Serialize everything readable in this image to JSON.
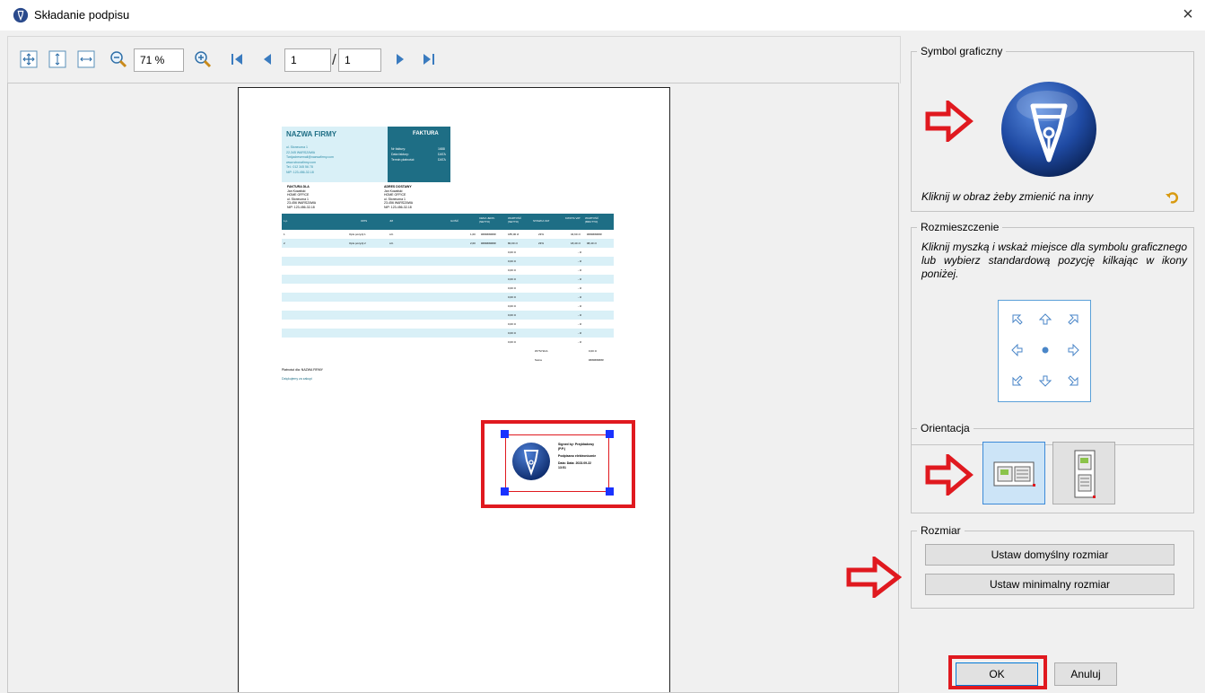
{
  "window": {
    "title": "Składanie podpisu",
    "close_label": "×"
  },
  "toolbar": {
    "zoom_value": "71 %",
    "page_current": "1",
    "page_separator": "/",
    "page_total": "1"
  },
  "invoice": {
    "company": "NAZWA FIRMY",
    "doc_title": "FAKTURA",
    "company_lines": [
      "ul. Słoneczna 1",
      "22-345 WARSZAWA",
      "Twójadresemail@nazwafirmy.com",
      "www.stronafirmy.com",
      "Tel.: 012 345 56 78",
      "NIP: 123-456-32-18"
    ],
    "meta_labels": [
      "Nr faktury:",
      "Data faktury:",
      "Termin płatności:"
    ],
    "meta_values": [
      "1688",
      "DATA",
      "DATA"
    ],
    "bill_to_title": "FAKTURA DLA",
    "bill_to_lines": [
      "Jan Kowalski",
      "HOME OFFICE",
      "ul. Słoneczna 1",
      "23-456 WARSZAWA",
      "NIP: 123-456-32-18"
    ],
    "ship_to_title": "ADRES DOSTAWY",
    "ship_to_lines": [
      "Jan Kowalski",
      "HOME OFFICE",
      "ul. Słoneczna 1",
      "23-456 WARSZAWA",
      "NIP: 123-456-32-18"
    ],
    "table_headers": [
      "L.p.",
      "OPIS",
      "JM",
      "ILOŚĆ",
      "CENA JEDN. (NETTO)",
      "WARTOŚĆ (NETTO)",
      "STAWKA VAT",
      "KWOTA VAT",
      "WARTOŚĆ (BRUTTO)"
    ],
    "rows": [
      [
        "1",
        "Opis pozycji 1",
        "szt.",
        "1,00",
        "##########",
        "185,00 zł",
        "23%",
        "34,60 zł",
        "##########"
      ],
      [
        "2",
        "Opis pozycji 2",
        "szt.",
        "2,00",
        "##########",
        "80,00 zł",
        "23%",
        "18,40 zł",
        "98,40 zł"
      ]
    ],
    "empty_row_net": "0,00 zł",
    "empty_row_vat": "- zł",
    "summary_labels": [
      "WYSYŁKA",
      "Suma"
    ],
    "summary_values": [
      "0,00 zł",
      "##########"
    ],
    "footer_line": "Płatności dla: NAZWA FIRMY",
    "thanks": "Dziękujemy za zakupi"
  },
  "signature_stamp": {
    "lines": [
      "Signed by: Przykładowy",
      "(P.P.)",
      "Podpisano elektronicznie",
      "Data: Data: 2023.09.22",
      "13:51"
    ]
  },
  "symbol_group": {
    "legend": "Symbol graficzny",
    "hint": "Kliknij w obraz żeby zmienić na inny"
  },
  "placement_group": {
    "legend": "Rozmieszczenie",
    "instructions": "Kliknij myszką i wskaż miejsce dla symbolu graficznego lub wybierz standardową pozycję kilkając w ikony poniżej."
  },
  "orientation_group": {
    "legend": "Orientacja"
  },
  "size_group": {
    "legend": "Rozmiar",
    "default_size_label": "Ustaw domyślny rozmiar",
    "min_size_label": "Ustaw minimalny rozmiar"
  },
  "dialog_buttons": {
    "ok_label": "OK",
    "cancel_label": "Anuluj"
  },
  "colors": {
    "accent_red": "#e0191f",
    "invoice_teal": "#1e6e85",
    "invoice_light": "#d9f0f7",
    "handle_blue": "#1a32ff"
  }
}
